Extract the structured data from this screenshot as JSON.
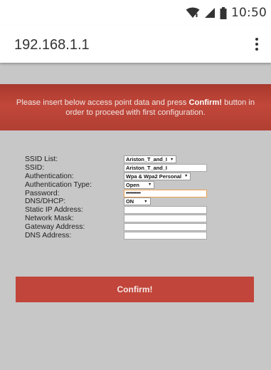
{
  "status_bar": {
    "time": "10:50",
    "icons": [
      "wifi-icon",
      "signal-icon",
      "battery-icon"
    ]
  },
  "browser": {
    "url": "192.168.1.1",
    "menu_icon": "more-vert-icon"
  },
  "notice": {
    "text_before": "Please insert below access point data and press ",
    "bold": "Confirm!",
    "text_after": " button in order to proceed with first configuration."
  },
  "form": {
    "ssid_list": {
      "label": "SSID List:",
      "value": "Ariston_T_and_I"
    },
    "ssid": {
      "label": "SSID:",
      "value": "Ariston_T_and_I"
    },
    "authentication": {
      "label": "Authentication:",
      "value": "Wpa & Wpa2 Personal"
    },
    "authentication_type": {
      "label": "Authentication Type:",
      "value": "Open"
    },
    "password": {
      "label": "Password:",
      "value": "••••••••••"
    },
    "dns_dhcp": {
      "label": "DNS/DHCP:",
      "value": "ON"
    },
    "static_ip": {
      "label": "Static IP Address:",
      "value": ""
    },
    "network_mask": {
      "label": "Network Mask:",
      "value": ""
    },
    "gateway": {
      "label": "Gateway Address:",
      "value": ""
    },
    "dns_address": {
      "label": "DNS Address:",
      "value": ""
    }
  },
  "confirm_button": {
    "label": "Confirm!"
  },
  "colors": {
    "banner": "#b8433a",
    "button": "#c1453a",
    "page_background": "#c7c7c7",
    "focus_border": "#e6a35a"
  }
}
